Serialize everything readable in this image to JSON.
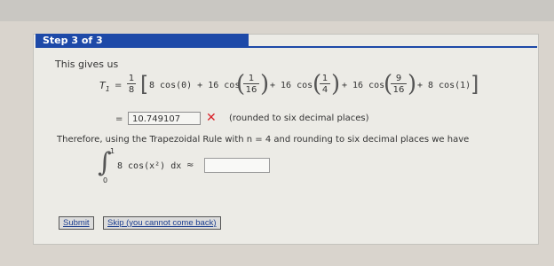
{
  "step_label": "Step 3 of 3",
  "intro_text": "This gives us",
  "t1_label": "T",
  "t1_sub": "1",
  "eq": "=",
  "coef_num": "1",
  "coef_den": "8",
  "term1": "8 cos(0) + 16 cos",
  "f1_num": "1",
  "f1_den": "16",
  "plus_16cos_a": "+ 16 cos",
  "f2_num": "1",
  "f2_den": "4",
  "plus_16cos_b": "+ 16 cos",
  "f3_num": "9",
  "f3_den": "16",
  "tail": "+ 8 cos(1)",
  "answer_value": "10.749107",
  "incorrect_mark": "✕",
  "rounding_note": "(rounded to six decimal places)",
  "therefore_text": "Therefore, using the Trapezoidal Rule with n = 4 and rounding to six decimal places we have",
  "integral_upper": "1",
  "integral_lower": "0",
  "integrand": "8 cos(x²) dx",
  "approx": "≈",
  "final_input_value": "",
  "submit_label": "Submit",
  "skip_label": "Skip (you cannot come back)"
}
